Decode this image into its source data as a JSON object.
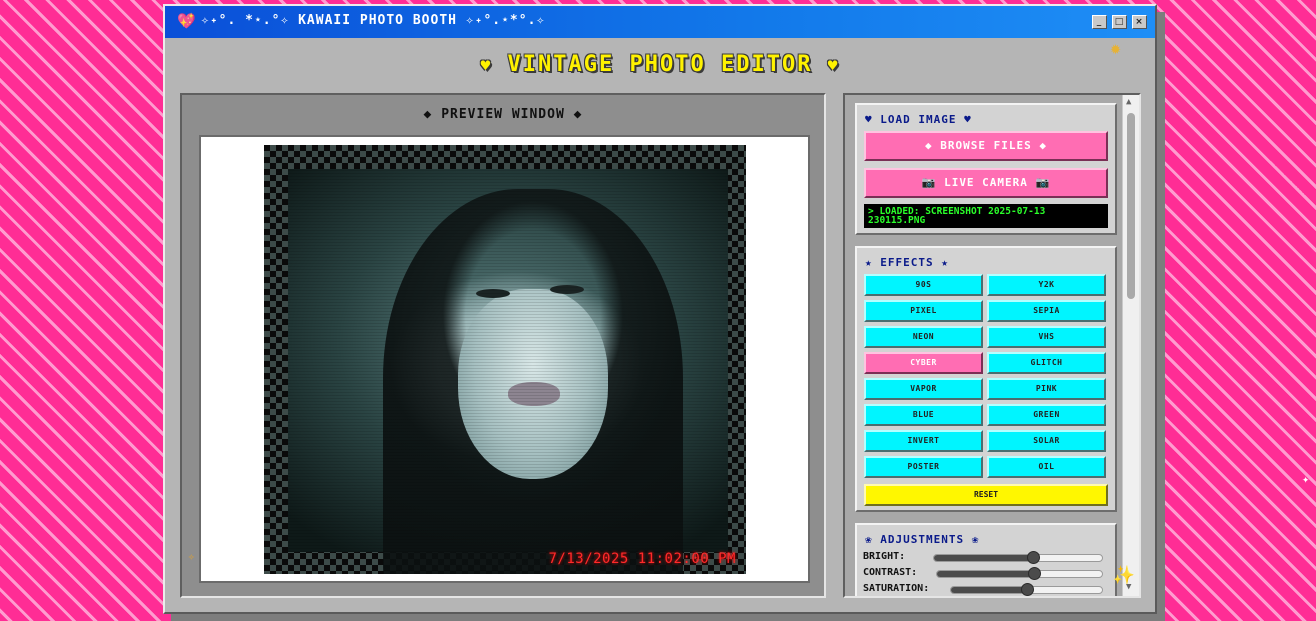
{
  "window": {
    "title": "Kawaii Photo Booth",
    "title_prefix_icon": "heart-sparkle-icon",
    "title_text": "✧˖°. *⋆.°✧ KAWAII PHOTO BOOTH ✧˖°.⋆*°.✧",
    "controls": [
      "_",
      "□",
      "×"
    ]
  },
  "header": {
    "left_heart": "♥",
    "title": "VINTAGE PHOTO EDITOR",
    "right_heart": "♥"
  },
  "preview": {
    "title": "◆ PREVIEW WINDOW ◆",
    "timestamp": "7/13/2025 11:02:00 PM"
  },
  "load_image": {
    "title": "♥ LOAD IMAGE ♥",
    "browse_label": "◆ BROWSE FILES ◆",
    "camera_label": "📷 LIVE CAMERA 📷",
    "status": "> LOADED: SCREENSHOT 2025-07-13 230115.PNG"
  },
  "effects": {
    "title": "★ EFFECTS ★",
    "buttons": [
      "90S",
      "Y2K",
      "PIXEL",
      "SEPIA",
      "NEON",
      "VHS",
      "CYBER",
      "GLITCH",
      "VAPOR",
      "PINK",
      "BLUE",
      "GREEN",
      "INVERT",
      "SOLAR",
      "POSTER",
      "OIL"
    ],
    "active": "CYBER",
    "reset_label": "RESET"
  },
  "adjustments": {
    "title": "❀ ADJUSTMENTS ❀",
    "sliders": [
      {
        "label": "BRIGHT:",
        "value": 0.59
      },
      {
        "label": "CONTRAST:",
        "value": 0.59
      },
      {
        "label": "SATURATION:",
        "value": 0.5
      }
    ]
  },
  "colors": {
    "titlebar": "#1279ea",
    "header_text": "#fff200",
    "effect_button": "#00f5ff",
    "active_button": "#ff6db3",
    "reset_button": "#fff700",
    "status_text": "#2aff2a",
    "timestamp": "#ff2a2a"
  }
}
